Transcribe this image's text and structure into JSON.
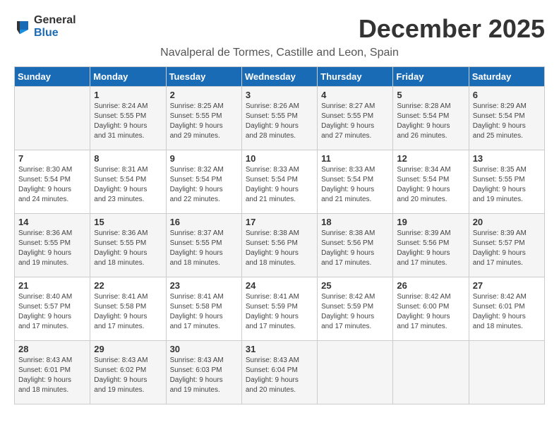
{
  "logo": {
    "general": "General",
    "blue": "Blue"
  },
  "title": "December 2025",
  "location": "Navalperal de Tormes, Castille and Leon, Spain",
  "days_of_week": [
    "Sunday",
    "Monday",
    "Tuesday",
    "Wednesday",
    "Thursday",
    "Friday",
    "Saturday"
  ],
  "weeks": [
    [
      {
        "day": "",
        "info": ""
      },
      {
        "day": "1",
        "info": "Sunrise: 8:24 AM\nSunset: 5:55 PM\nDaylight: 9 hours\nand 31 minutes."
      },
      {
        "day": "2",
        "info": "Sunrise: 8:25 AM\nSunset: 5:55 PM\nDaylight: 9 hours\nand 29 minutes."
      },
      {
        "day": "3",
        "info": "Sunrise: 8:26 AM\nSunset: 5:55 PM\nDaylight: 9 hours\nand 28 minutes."
      },
      {
        "day": "4",
        "info": "Sunrise: 8:27 AM\nSunset: 5:55 PM\nDaylight: 9 hours\nand 27 minutes."
      },
      {
        "day": "5",
        "info": "Sunrise: 8:28 AM\nSunset: 5:54 PM\nDaylight: 9 hours\nand 26 minutes."
      },
      {
        "day": "6",
        "info": "Sunrise: 8:29 AM\nSunset: 5:54 PM\nDaylight: 9 hours\nand 25 minutes."
      }
    ],
    [
      {
        "day": "7",
        "info": "Sunrise: 8:30 AM\nSunset: 5:54 PM\nDaylight: 9 hours\nand 24 minutes."
      },
      {
        "day": "8",
        "info": "Sunrise: 8:31 AM\nSunset: 5:54 PM\nDaylight: 9 hours\nand 23 minutes."
      },
      {
        "day": "9",
        "info": "Sunrise: 8:32 AM\nSunset: 5:54 PM\nDaylight: 9 hours\nand 22 minutes."
      },
      {
        "day": "10",
        "info": "Sunrise: 8:33 AM\nSunset: 5:54 PM\nDaylight: 9 hours\nand 21 minutes."
      },
      {
        "day": "11",
        "info": "Sunrise: 8:33 AM\nSunset: 5:54 PM\nDaylight: 9 hours\nand 21 minutes."
      },
      {
        "day": "12",
        "info": "Sunrise: 8:34 AM\nSunset: 5:54 PM\nDaylight: 9 hours\nand 20 minutes."
      },
      {
        "day": "13",
        "info": "Sunrise: 8:35 AM\nSunset: 5:55 PM\nDaylight: 9 hours\nand 19 minutes."
      }
    ],
    [
      {
        "day": "14",
        "info": "Sunrise: 8:36 AM\nSunset: 5:55 PM\nDaylight: 9 hours\nand 19 minutes."
      },
      {
        "day": "15",
        "info": "Sunrise: 8:36 AM\nSunset: 5:55 PM\nDaylight: 9 hours\nand 18 minutes."
      },
      {
        "day": "16",
        "info": "Sunrise: 8:37 AM\nSunset: 5:55 PM\nDaylight: 9 hours\nand 18 minutes."
      },
      {
        "day": "17",
        "info": "Sunrise: 8:38 AM\nSunset: 5:56 PM\nDaylight: 9 hours\nand 18 minutes."
      },
      {
        "day": "18",
        "info": "Sunrise: 8:38 AM\nSunset: 5:56 PM\nDaylight: 9 hours\nand 17 minutes."
      },
      {
        "day": "19",
        "info": "Sunrise: 8:39 AM\nSunset: 5:56 PM\nDaylight: 9 hours\nand 17 minutes."
      },
      {
        "day": "20",
        "info": "Sunrise: 8:39 AM\nSunset: 5:57 PM\nDaylight: 9 hours\nand 17 minutes."
      }
    ],
    [
      {
        "day": "21",
        "info": "Sunrise: 8:40 AM\nSunset: 5:57 PM\nDaylight: 9 hours\nand 17 minutes."
      },
      {
        "day": "22",
        "info": "Sunrise: 8:41 AM\nSunset: 5:58 PM\nDaylight: 9 hours\nand 17 minutes."
      },
      {
        "day": "23",
        "info": "Sunrise: 8:41 AM\nSunset: 5:58 PM\nDaylight: 9 hours\nand 17 minutes."
      },
      {
        "day": "24",
        "info": "Sunrise: 8:41 AM\nSunset: 5:59 PM\nDaylight: 9 hours\nand 17 minutes."
      },
      {
        "day": "25",
        "info": "Sunrise: 8:42 AM\nSunset: 5:59 PM\nDaylight: 9 hours\nand 17 minutes."
      },
      {
        "day": "26",
        "info": "Sunrise: 8:42 AM\nSunset: 6:00 PM\nDaylight: 9 hours\nand 17 minutes."
      },
      {
        "day": "27",
        "info": "Sunrise: 8:42 AM\nSunset: 6:01 PM\nDaylight: 9 hours\nand 18 minutes."
      }
    ],
    [
      {
        "day": "28",
        "info": "Sunrise: 8:43 AM\nSunset: 6:01 PM\nDaylight: 9 hours\nand 18 minutes."
      },
      {
        "day": "29",
        "info": "Sunrise: 8:43 AM\nSunset: 6:02 PM\nDaylight: 9 hours\nand 19 minutes."
      },
      {
        "day": "30",
        "info": "Sunrise: 8:43 AM\nSunset: 6:03 PM\nDaylight: 9 hours\nand 19 minutes."
      },
      {
        "day": "31",
        "info": "Sunrise: 8:43 AM\nSunset: 6:04 PM\nDaylight: 9 hours\nand 20 minutes."
      },
      {
        "day": "",
        "info": ""
      },
      {
        "day": "",
        "info": ""
      },
      {
        "day": "",
        "info": ""
      }
    ]
  ]
}
